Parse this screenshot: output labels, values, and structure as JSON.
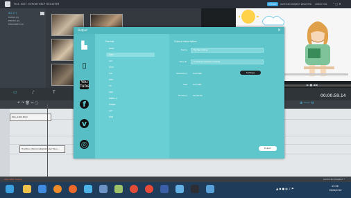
{
  "menu": [
    "FILE",
    "EDIT",
    "EXPORT",
    "HELP",
    "REGISTER"
  ],
  "right_menu": {
    "export": "EXPORT",
    "items": [
      "UNTITLED PROJECT",
      "REGISTER",
      "CHECK FOR"
    ]
  },
  "library": {
    "items": [
      "ALL (7)",
      "MUSIC (0)",
      "PHOTO (0)",
      "FAVOURITE (0)"
    ]
  },
  "timecode": "00:00:59.14",
  "timeline": {
    "clip1": "IMG_0465.MOV",
    "clip2": "Tradition_Memorable(Wonder Fans...",
    "add_track": "ADD NEW TRACK",
    "status": "UNTITLED PROJECT *"
  },
  "dialog": {
    "title": "Output",
    "format_heading": "Format",
    "formats": [
      "WMV",
      "MP4",
      "AVI",
      "MOV",
      "FLV",
      "MKV",
      "TS",
      "3GP",
      "MPEG-2",
      "WEBM",
      "GIF",
      "MP3"
    ],
    "selected": "MP4",
    "output_heading": "Output description",
    "fields": {
      "name_label": "Name",
      "name_value": "My Recording",
      "save_label": "Save to",
      "save_value": "C:/Users/user/Documents",
      "resolution_label": "Resolution",
      "resolution_value": "640*480",
      "size_label": "Size",
      "size_value": "64.5 MB",
      "duration_label": "Duration",
      "duration_value": "00:00:59"
    },
    "settings": "Settings",
    "export": "Export"
  },
  "taskbar": {
    "time": "13:06",
    "date": "19/04/2016"
  }
}
